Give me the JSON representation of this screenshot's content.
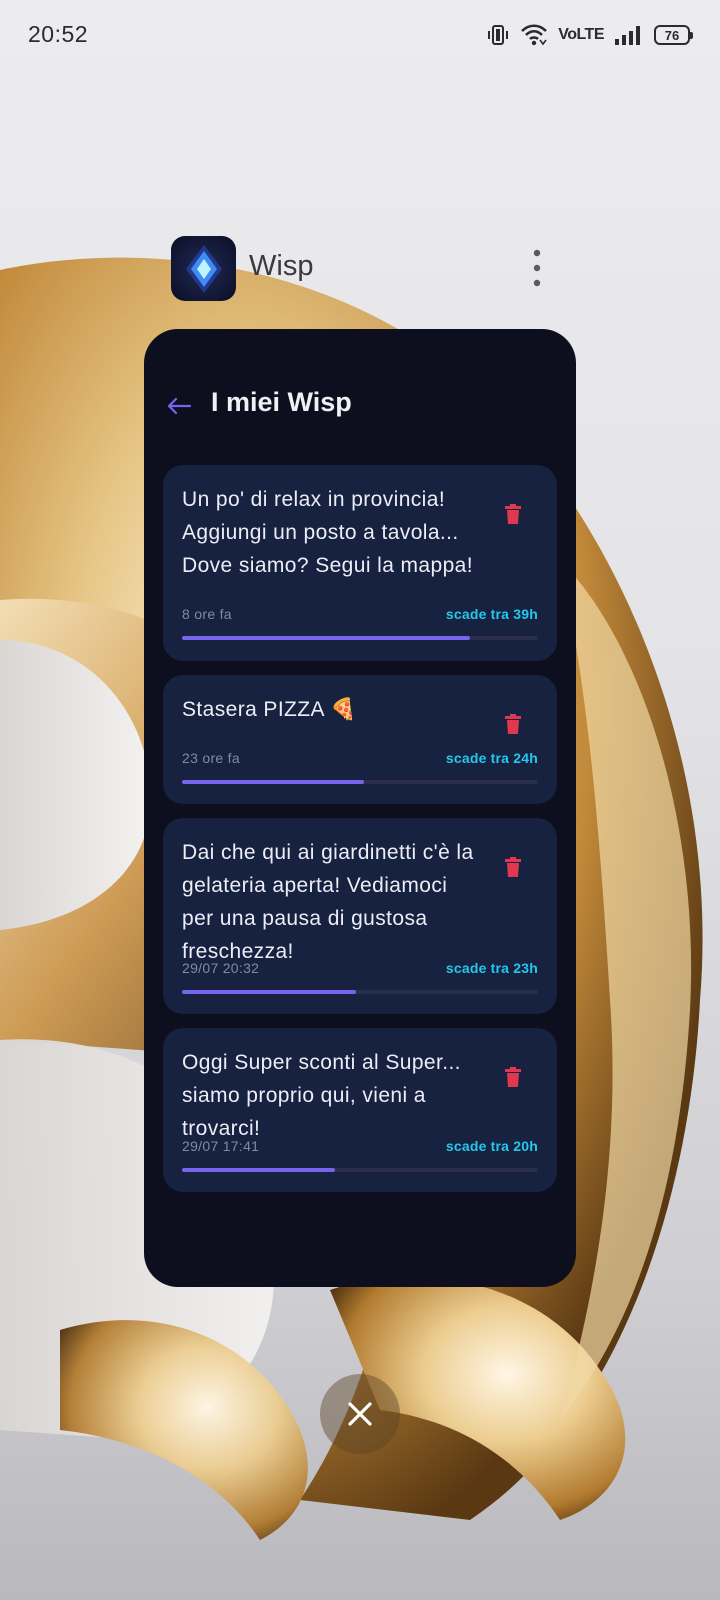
{
  "status_bar": {
    "time": "20:52",
    "network_label": "VoLTE",
    "battery_level": "76",
    "icons": [
      "vibrate-icon",
      "wifi-icon",
      "volte-icon",
      "signal-icon",
      "battery-icon"
    ]
  },
  "recents": {
    "app_name": "Wisp",
    "menu_icon": "more-vertical-icon",
    "close_icon": "close-icon"
  },
  "screen": {
    "back_icon": "back-arrow-icon",
    "title": "I miei Wisp",
    "accent_color": "#7765f0",
    "expiry_color": "#25c8e8",
    "delete_color": "#e0384e"
  },
  "wisps": [
    {
      "text": "Un po' di relax in provincia! Aggiungi un posto a tavola... Dove siamo? Segui la mappa!",
      "time": "8 ore fa",
      "expiry": "scade tra 39h",
      "progress": 0.81
    },
    {
      "text": "Stasera PIZZA 🍕",
      "time": "23 ore fa",
      "expiry": "scade tra 24h",
      "progress": 0.51
    },
    {
      "text": "Dai che qui ai giardinetti c'è la gelateria aperta! Vediamoci per una pausa di gustosa freschezza!",
      "time": "29/07 20:32",
      "expiry": "scade tra 23h",
      "progress": 0.49
    },
    {
      "text": "Oggi Super sconti al Super... siamo proprio qui, vieni a trovarci!",
      "time": "29/07 17:41",
      "expiry": "scade tra 20h",
      "progress": 0.43
    }
  ]
}
